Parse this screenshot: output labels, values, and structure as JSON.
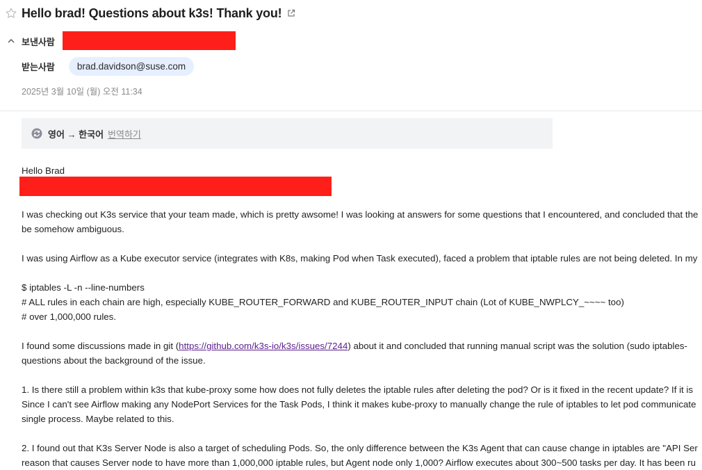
{
  "header": {
    "subject": "Hello brad! Questions about k3s! Thank you!",
    "sender_label": "보낸사람",
    "recipient_label": "받는사람",
    "recipient_email": "brad.davidson@suse.com",
    "date": "2025년 3월 10일 (월) 오전 11:34"
  },
  "translate": {
    "languages": "영어 → 한국어",
    "action": "번역하기"
  },
  "body": {
    "greeting": "Hello Brad",
    "p1_line1": "I was checking out K3s service that your team made, which is pretty awsome! I was looking at answers for some questions that I encountered, and concluded that the",
    "p1_line2": "be somehow ambiguous.",
    "p2_line1": "I was using Airflow as a Kube executor service (integrates with K8s, making Pod when Task executed), faced a problem that iptable rules are not being deleted. In my",
    "code1": "$ iptables -L -n --line-numbers",
    "code2": "# ALL rules in each chain are high, especially KUBE_ROUTER_FORWARD and KUBE_ROUTER_INPUT chain (Lot of KUBE_NWPLCY_~~~~ too)",
    "code3": "# over 1,000,000 rules.",
    "p3_before": "I found some discussions made in git (",
    "p3_link": "https://github.com/k3s-io/k3s/issues/7244",
    "p3_after": ") about it and concluded that running manual script was the solution (sudo iptables-",
    "p3_line2": "questions about the background of the issue.",
    "q1_line1": "1. Is there still a problem within k3s that kube-proxy some how does not fully deletes the iptable rules after deleting the pod? Or is it fixed in the recent update? If it is",
    "q1_line2": "Since I can't see Airflow making any NodePort Services for the Task Pods, I think it makes kube-proxy to manually change the rule of iptables to let pod communicate",
    "q1_line3": "single process. Maybe related to this.",
    "q2_line1": "2. I found out that K3s Server Node is also a target of scheduling Pods. So, the only difference between the K3s Agent that can cause change in iptables are \"API Ser",
    "q2_line2": "reason that causes Server node to have more than 1,000,000 iptable rules, but Agent node only 1,000? Airflow executes about 300~500 tasks per day. It has been ru"
  },
  "colors": {
    "redaction": "#ff1f1a",
    "chip_bg": "#e6efff",
    "link": "#5a1e8c"
  },
  "icons": [
    "star-icon",
    "external-link-icon",
    "chevron-up-icon",
    "translate-icon"
  ]
}
